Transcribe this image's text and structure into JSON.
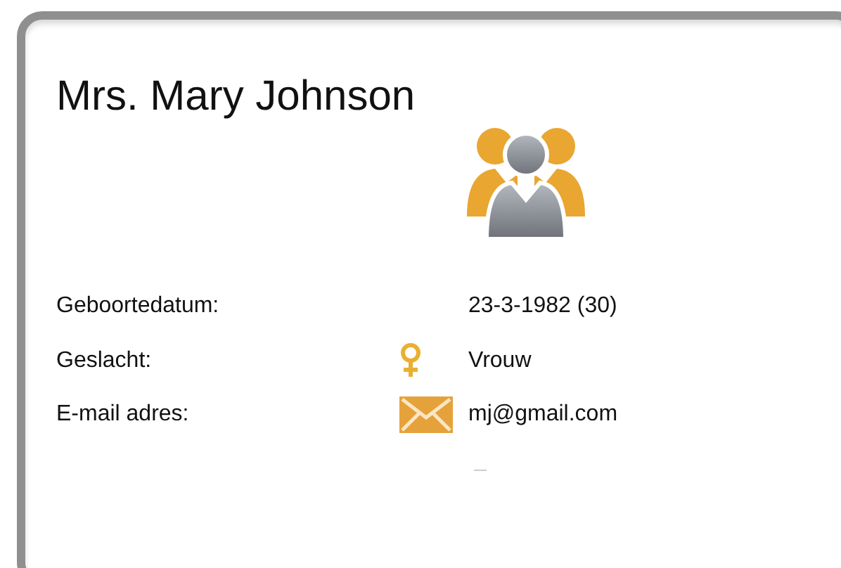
{
  "card": {
    "name": "Mrs. Mary Johnson"
  },
  "fields": [
    {
      "kind": "plain",
      "label": "Geboortedatum:",
      "value": "23-3-1982 (30)"
    },
    {
      "kind": "gender",
      "label": "Geslacht:",
      "value": "Vrouw"
    },
    {
      "kind": "email",
      "label": "E-mail adres:",
      "value": "mj@gmail.com"
    }
  ]
}
